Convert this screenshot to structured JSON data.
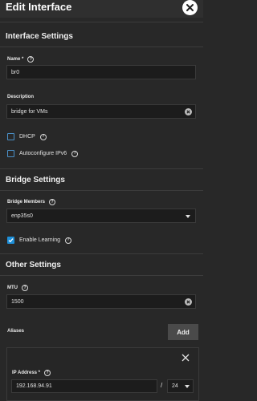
{
  "header": {
    "title": "Edit Interface"
  },
  "sections": {
    "interface": "Interface Settings",
    "bridge": "Bridge Settings",
    "other": "Other Settings"
  },
  "fields": {
    "name": {
      "label": "Name *",
      "value": "br0"
    },
    "description": {
      "label": "Description",
      "value": "bridge for VMs"
    },
    "dhcp": {
      "label": "DHCP",
      "checked": false
    },
    "ipv6": {
      "label": "Autoconfigure IPv6",
      "checked": false
    },
    "bridge_members": {
      "label": "Bridge Members",
      "value": "enp35s0"
    },
    "enable_learning": {
      "label": "Enable Learning",
      "checked": true
    },
    "mtu": {
      "label": "MTU",
      "value": "1500"
    }
  },
  "aliases": {
    "label": "Aliases",
    "add_label": "Add",
    "ip_label": "IP Address *",
    "ip_value": "192.168.94.91",
    "separator": "/",
    "netmask": "24"
  },
  "help_glyph": "?",
  "colors": {
    "accent": "#1e8fd8",
    "background": "#282828",
    "input": "#1c1c1c"
  }
}
